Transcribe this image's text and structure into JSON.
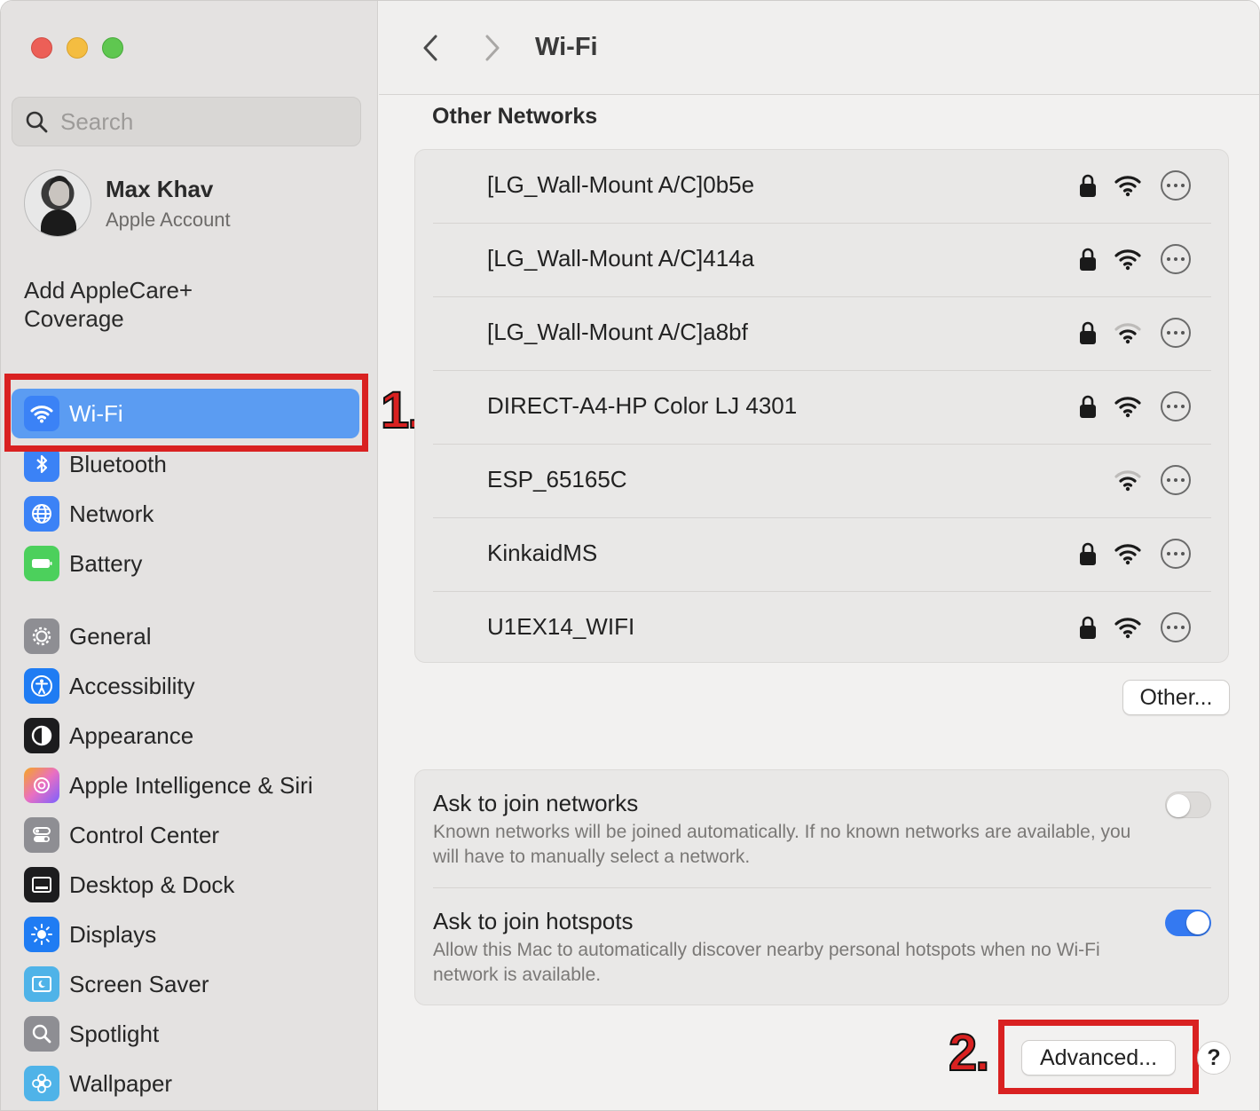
{
  "window": {
    "title": "Wi-Fi"
  },
  "search": {
    "placeholder": "Search"
  },
  "account": {
    "name": "Max Khav",
    "subtitle": "Apple Account"
  },
  "applecare": {
    "label": "Add AppleCare+ Coverage"
  },
  "sidebar": {
    "items": [
      {
        "label": "Wi-Fi",
        "icon": "wifi-icon",
        "color": "#3b82f6",
        "active": true
      },
      {
        "label": "Bluetooth",
        "icon": "bluetooth-icon",
        "color": "#3b82f6"
      },
      {
        "label": "Network",
        "icon": "globe-icon",
        "color": "#3b82f6"
      },
      {
        "label": "Battery",
        "icon": "battery-icon",
        "color": "#4cd05c"
      },
      {
        "label": "General",
        "icon": "gear-icon",
        "color": "#8e8e93"
      },
      {
        "label": "Accessibility",
        "icon": "accessibility-icon",
        "color": "#1f7cf3"
      },
      {
        "label": "Appearance",
        "icon": "appearance-icon",
        "color": "#1c1c1e"
      },
      {
        "label": "Apple Intelligence & Siri",
        "icon": "siri-icon",
        "color": "#e96fc2"
      },
      {
        "label": "Control Center",
        "icon": "toggles-icon",
        "color": "#8e8e93"
      },
      {
        "label": "Desktop & Dock",
        "icon": "dock-icon",
        "color": "#1c1c1e"
      },
      {
        "label": "Displays",
        "icon": "sun-icon",
        "color": "#1f7cf3"
      },
      {
        "label": "Screen Saver",
        "icon": "screensaver-icon",
        "color": "#4fb3e8"
      },
      {
        "label": "Spotlight",
        "icon": "magnifier-icon",
        "color": "#8e8e93"
      },
      {
        "label": "Wallpaper",
        "icon": "flower-icon",
        "color": "#4fb3e8"
      }
    ]
  },
  "annotations": {
    "step1": "1.",
    "step2": "2."
  },
  "main": {
    "section_title": "Other Networks",
    "networks": [
      {
        "name": "[LG_Wall-Mount A/C]0b5e",
        "locked": true,
        "signal": "strong"
      },
      {
        "name": "[LG_Wall-Mount A/C]414a",
        "locked": true,
        "signal": "strong"
      },
      {
        "name": "[LG_Wall-Mount A/C]a8bf",
        "locked": true,
        "signal": "weak"
      },
      {
        "name": "DIRECT-A4-HP Color LJ 4301",
        "locked": true,
        "signal": "strong"
      },
      {
        "name": "ESP_65165C",
        "locked": false,
        "signal": "weak"
      },
      {
        "name": "KinkaidMS",
        "locked": true,
        "signal": "strong"
      },
      {
        "name": "U1EX14_WIFI",
        "locked": true,
        "signal": "strong"
      }
    ],
    "other_button": "Other...",
    "options": [
      {
        "title": "Ask to join networks",
        "desc": "Known networks will be joined automatically. If no known networks are available, you will have to manually select a network.",
        "enabled": false
      },
      {
        "title": "Ask to join hotspots",
        "desc": "Allow this Mac to automatically discover nearby personal hotspots when no Wi-Fi network is available.",
        "enabled": true
      }
    ],
    "advanced_button": "Advanced...",
    "help_button": "?"
  }
}
